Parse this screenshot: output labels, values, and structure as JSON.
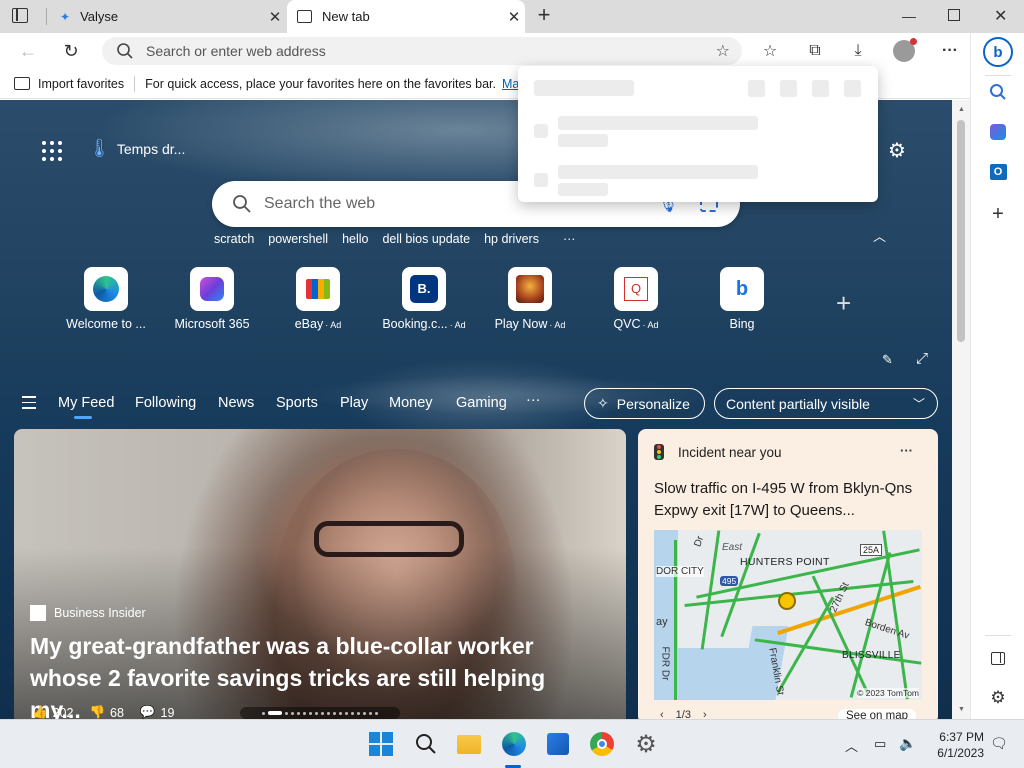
{
  "tabs": [
    {
      "title": "Valyse"
    },
    {
      "title": "New tab"
    }
  ],
  "address_bar": {
    "placeholder": "Search or enter web address"
  },
  "favorites_bar": {
    "import_label": "Import favorites",
    "hint": "For quick access, place your favorites here on the favorites bar.",
    "manage_link": "Mana"
  },
  "weather": {
    "label": "Temps dr..."
  },
  "search": {
    "placeholder": "Search the web",
    "suggestions": [
      "scratch",
      "powershell",
      "hello",
      "dell bios update",
      "hp drivers"
    ],
    "more": "···"
  },
  "quick_links": [
    {
      "label": "Welcome to ...",
      "icon": "edge-icon",
      "ad": ""
    },
    {
      "label": "Microsoft 365",
      "icon": "m365-icon",
      "ad": ""
    },
    {
      "label": "eBay",
      "icon": "ebay-icon",
      "ad": "· Ad"
    },
    {
      "label": "Booking.c...",
      "icon": "booking-icon",
      "ad": "· Ad"
    },
    {
      "label": "Play Now",
      "icon": "game-icon",
      "ad": "· Ad"
    },
    {
      "label": "QVC",
      "icon": "qvc-icon",
      "ad": "· Ad"
    },
    {
      "label": "Bing",
      "icon": "bing-icon",
      "ad": ""
    }
  ],
  "feed_nav": {
    "items": [
      "My Feed",
      "Following",
      "News",
      "Sports",
      "Play",
      "Money",
      "Gaming"
    ],
    "more": "···",
    "personalize": "Personalize",
    "visibility": "Content partially visible"
  },
  "hero": {
    "source": "Business Insider",
    "headline": "My great-grandfather was a blue-collar worker whose 2 favorite savings tricks are still helping my...",
    "likes": "202",
    "dislikes": "68",
    "comments": "19"
  },
  "incident": {
    "title": "Incident near you",
    "more": "···",
    "body": "Slow traffic on I-495 W from Bklyn-Qns Expwy exit [17W] to Queens...",
    "map_labels": [
      "East",
      "DOR CITY",
      "HUNTERS POINT",
      "25A",
      "495",
      "ay",
      "Borden Av",
      "BLISSVILLE",
      "Franklin St",
      "27th St",
      "FDR Dr",
      "Dr"
    ],
    "copyright": "© 2023 TomTom",
    "pager": "1/3",
    "see_on_map": "See on map"
  },
  "taskbar": {
    "time": "6:37 PM",
    "date": "6/1/2023"
  },
  "colors": {
    "accent": "#0078d4",
    "page_bg": "#163a5b",
    "incident_bg": "#fbeee3"
  }
}
